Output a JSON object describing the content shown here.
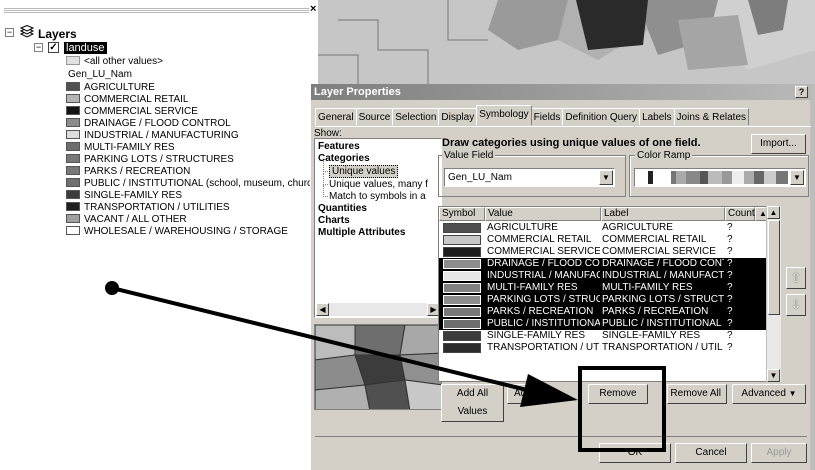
{
  "toc": {
    "root_label": "Layers",
    "layer_label": "landuse",
    "all_other_values": "<all other values>",
    "field_heading": "Gen_LU_Nam",
    "items": [
      {
        "label": "AGRICULTURE",
        "color": "#505050"
      },
      {
        "label": "COMMERCIAL RETAIL",
        "color": "#b4b4b4"
      },
      {
        "label": "COMMERCIAL SERVICE",
        "color": "#141414"
      },
      {
        "label": "DRAINAGE / FLOOD CONTROL",
        "color": "#8c8c8c"
      },
      {
        "label": "INDUSTRIAL / MANUFACTURING",
        "color": "#dcdcdc"
      },
      {
        "label": "MULTI-FAMILY RES",
        "color": "#6e6e6e"
      },
      {
        "label": "PARKING LOTS / STRUCTURES",
        "color": "#787878"
      },
      {
        "label": "PARKS / RECREATION",
        "color": "#787878"
      },
      {
        "label": "PUBLIC / INSTITUTIONAL (school, museum, church",
        "color": "#707070"
      },
      {
        "label": "SINGLE-FAMILY RES",
        "color": "#3c3c3c"
      },
      {
        "label": "TRANSPORTATION / UTILITIES",
        "color": "#1e1e1e"
      },
      {
        "label": "VACANT / ALL OTHER",
        "color": "#a0a0a0"
      },
      {
        "label": "WHOLESALE / WAREHOUSING / STORAGE",
        "color": "#ffffff"
      }
    ]
  },
  "dialog": {
    "title": "Layer Properties",
    "help": "?",
    "close": "x",
    "tabs": [
      "General",
      "Source",
      "Selection",
      "Display",
      "Symbology",
      "Fields",
      "Definition Query",
      "Labels",
      "Joins & Relates"
    ],
    "active_tab": "Symbology",
    "show_label": "Show:",
    "show_items": [
      {
        "label": "Features",
        "type": "b"
      },
      {
        "label": "Categories",
        "type": "b"
      },
      {
        "label": "Unique values",
        "type": "sub",
        "selected": true
      },
      {
        "label": "Unique values, many f",
        "type": "sub"
      },
      {
        "label": "Match to symbols in a",
        "type": "sub"
      },
      {
        "label": "Quantities",
        "type": "b"
      },
      {
        "label": "Charts",
        "type": "b"
      },
      {
        "label": "Multiple Attributes",
        "type": "b"
      }
    ],
    "description": "Draw categories using unique values of one field.",
    "import_label": "Import...",
    "value_field_label": "Value Field",
    "value_field_value": "Gen_LU_Nam",
    "color_ramp_label": "Color Ramp",
    "grid_headers": [
      "Symbol",
      "Value",
      "Label",
      "Count"
    ],
    "rows": [
      {
        "value": "AGRICULTURE",
        "label": "AGRICULTURE",
        "count": "?",
        "color": "#505050",
        "selected": false
      },
      {
        "value": "COMMERCIAL RETAIL",
        "label": "COMMERCIAL RETAIL",
        "count": "?",
        "color": "#c8c8c8",
        "selected": false
      },
      {
        "value": "COMMERCIAL SERVICE",
        "label": "COMMERCIAL SERVICE",
        "count": "?",
        "color": "#1e1e1e",
        "selected": false
      },
      {
        "value": "DRAINAGE / FLOOD CONT",
        "label": "DRAINAGE / FLOOD CONT",
        "count": "?",
        "color": "#8c8c8c",
        "selected": true
      },
      {
        "value": "INDUSTRIAL / MANUFACT",
        "label": "INDUSTRIAL / MANUFACT",
        "count": "?",
        "color": "#e6e6e6",
        "selected": true
      },
      {
        "value": "MULTI-FAMILY RES",
        "label": "MULTI-FAMILY RES",
        "count": "?",
        "color": "#828282",
        "selected": true
      },
      {
        "value": "PARKING LOTS / STRUCT",
        "label": "PARKING LOTS / STRUCT",
        "count": "?",
        "color": "#8c8c8c",
        "selected": true
      },
      {
        "value": "PARKS / RECREATION",
        "label": "PARKS / RECREATION",
        "count": "?",
        "color": "#787878",
        "selected": true
      },
      {
        "value": "PUBLIC / INSTITUTIONAL",
        "label": "PUBLIC / INSTITUTIONAL",
        "count": "?",
        "color": "#6e6e6e",
        "selected": true
      },
      {
        "value": "SINGLE-FAMILY RES",
        "label": "SINGLE-FAMILY RES",
        "count": "?",
        "color": "#3c3c3c",
        "selected": false
      },
      {
        "value": "TRANSPORTATION / UTIL",
        "label": "TRANSPORTATION / UTIL",
        "count": "?",
        "color": "#2a2a2a",
        "selected": false
      }
    ],
    "buttons": {
      "add_all": "Add All Values",
      "add": "Add",
      "remove": "Remove",
      "remove_all": "Remove All",
      "advanced": "Advanced",
      "ok": "OK",
      "cancel": "Cancel",
      "apply": "Apply"
    }
  }
}
